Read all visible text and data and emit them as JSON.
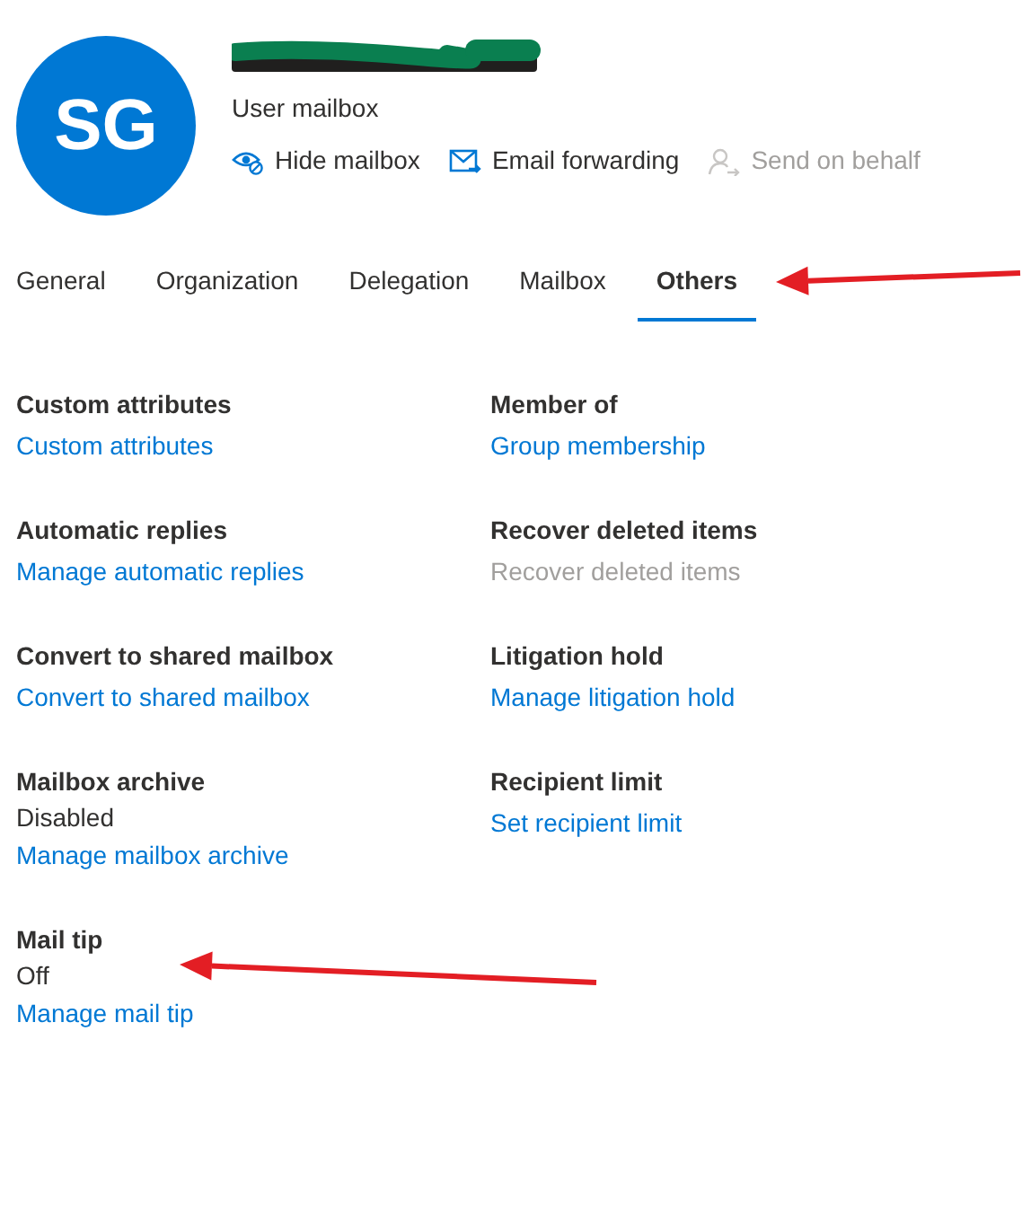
{
  "profile": {
    "initials": "SG",
    "name_redacted": true,
    "subtitle": "User mailbox",
    "actions": [
      {
        "kind": "hide",
        "label": "Hide mailbox",
        "disabled": false
      },
      {
        "kind": "forward",
        "label": "Email forwarding",
        "disabled": false
      },
      {
        "kind": "behalf",
        "label": "Send on behalf",
        "disabled": true
      }
    ]
  },
  "tabs": [
    {
      "label": "General",
      "selected": false
    },
    {
      "label": "Organization",
      "selected": false
    },
    {
      "label": "Delegation",
      "selected": false
    },
    {
      "label": "Mailbox",
      "selected": false
    },
    {
      "label": "Others",
      "selected": true
    }
  ],
  "sections": [
    [
      {
        "heading": "Custom attributes",
        "link": "Custom attributes",
        "disabled": false
      },
      {
        "heading": "Member of",
        "link": "Group membership",
        "disabled": false
      }
    ],
    [
      {
        "heading": "Automatic replies",
        "link": "Manage automatic replies",
        "disabled": false
      },
      {
        "heading": "Recover deleted items",
        "link": "Recover deleted items",
        "disabled": true
      }
    ],
    [
      {
        "heading": "Convert to shared mailbox",
        "link": "Convert to shared mailbox",
        "disabled": false
      },
      {
        "heading": "Litigation hold",
        "link": "Manage litigation hold",
        "disabled": false
      }
    ],
    [
      {
        "heading": "Mailbox archive",
        "value": "Disabled",
        "link": "Manage mailbox archive",
        "disabled": false
      },
      {
        "heading": "Recipient limit",
        "link": "Set recipient limit",
        "disabled": false
      }
    ],
    [
      {
        "heading": "Mail tip",
        "value": "Off",
        "link": "Manage mail tip",
        "disabled": false
      }
    ]
  ],
  "annotations": [
    {
      "kind": "arrow"
    },
    {
      "kind": "arrow"
    }
  ]
}
